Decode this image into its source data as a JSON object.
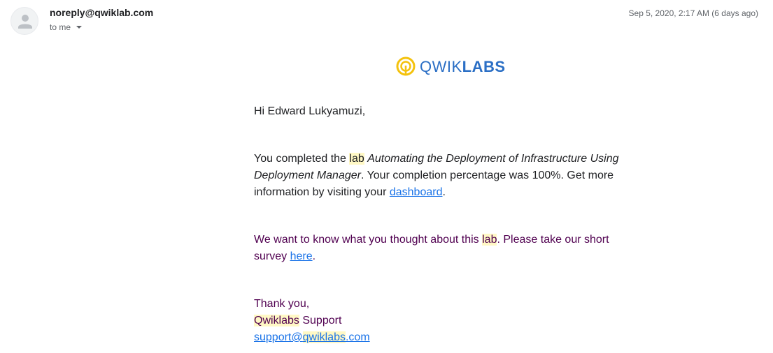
{
  "header": {
    "sender": "noreply@qwiklab.com",
    "recipient": "to me",
    "timestamp": "Sep 5, 2020, 2:17 AM (6 days ago)",
    "avatar_icon": "person-icon",
    "caret_icon": "chevron-down-icon"
  },
  "logo": {
    "text_light": "QWIK",
    "text_bold": "LABS",
    "brand_color": "#2b6fc5",
    "mark_color": "#f4c20d"
  },
  "email": {
    "greeting": "Hi Edward Lukyamuzi,",
    "p1_prefix": "You completed the ",
    "p1_lab": "lab",
    "p1_title": "Automating the Deployment of Infrastructure Using Deployment Manager",
    "p1_middle": ". Your completion percentage was 100%. Get more information by visiting your ",
    "p1_link": "dashboard",
    "p1_end": ".",
    "p2_prefix": "We want to know what you thought about this ",
    "p2_lab": "lab",
    "p2_middle": ". Please take our short survey ",
    "p2_link": "here",
    "p2_end": ".",
    "sig_thanks": "Thank you,",
    "sig_brand": "Qwiklabs",
    "sig_support": " Support",
    "sig_email_prefix": "support@",
    "sig_email_brand": "qwiklabs",
    "sig_email_suffix": ".com"
  },
  "colors": {
    "highlight": "#fff8c5",
    "link": "#1a73e8",
    "quoted_text": "#500050"
  }
}
